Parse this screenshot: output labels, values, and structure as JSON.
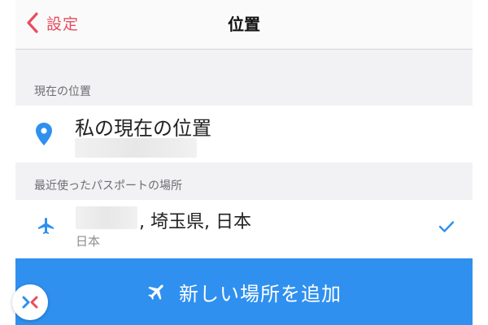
{
  "navbar": {
    "back_label": "設定",
    "title": "位置"
  },
  "current_location": {
    "header": "現在の位置",
    "title": "私の現在の位置"
  },
  "recent_passport": {
    "header": "最近使ったパスポートの場所",
    "title_suffix": ", 埼玉県, 日本",
    "subtitle": "日本",
    "selected": true
  },
  "add_button": {
    "label": "新しい場所を追加"
  },
  "colors": {
    "accent_red": "#e94c5f",
    "accent_blue": "#2f90ef",
    "background": "#f2f2f4"
  },
  "icons": {
    "back": "chevron-left-icon",
    "location": "location-pin-icon",
    "passport": "airplane-icon",
    "check": "checkmark-icon",
    "add": "airplane-icon",
    "logo": "app-logo-icon"
  }
}
